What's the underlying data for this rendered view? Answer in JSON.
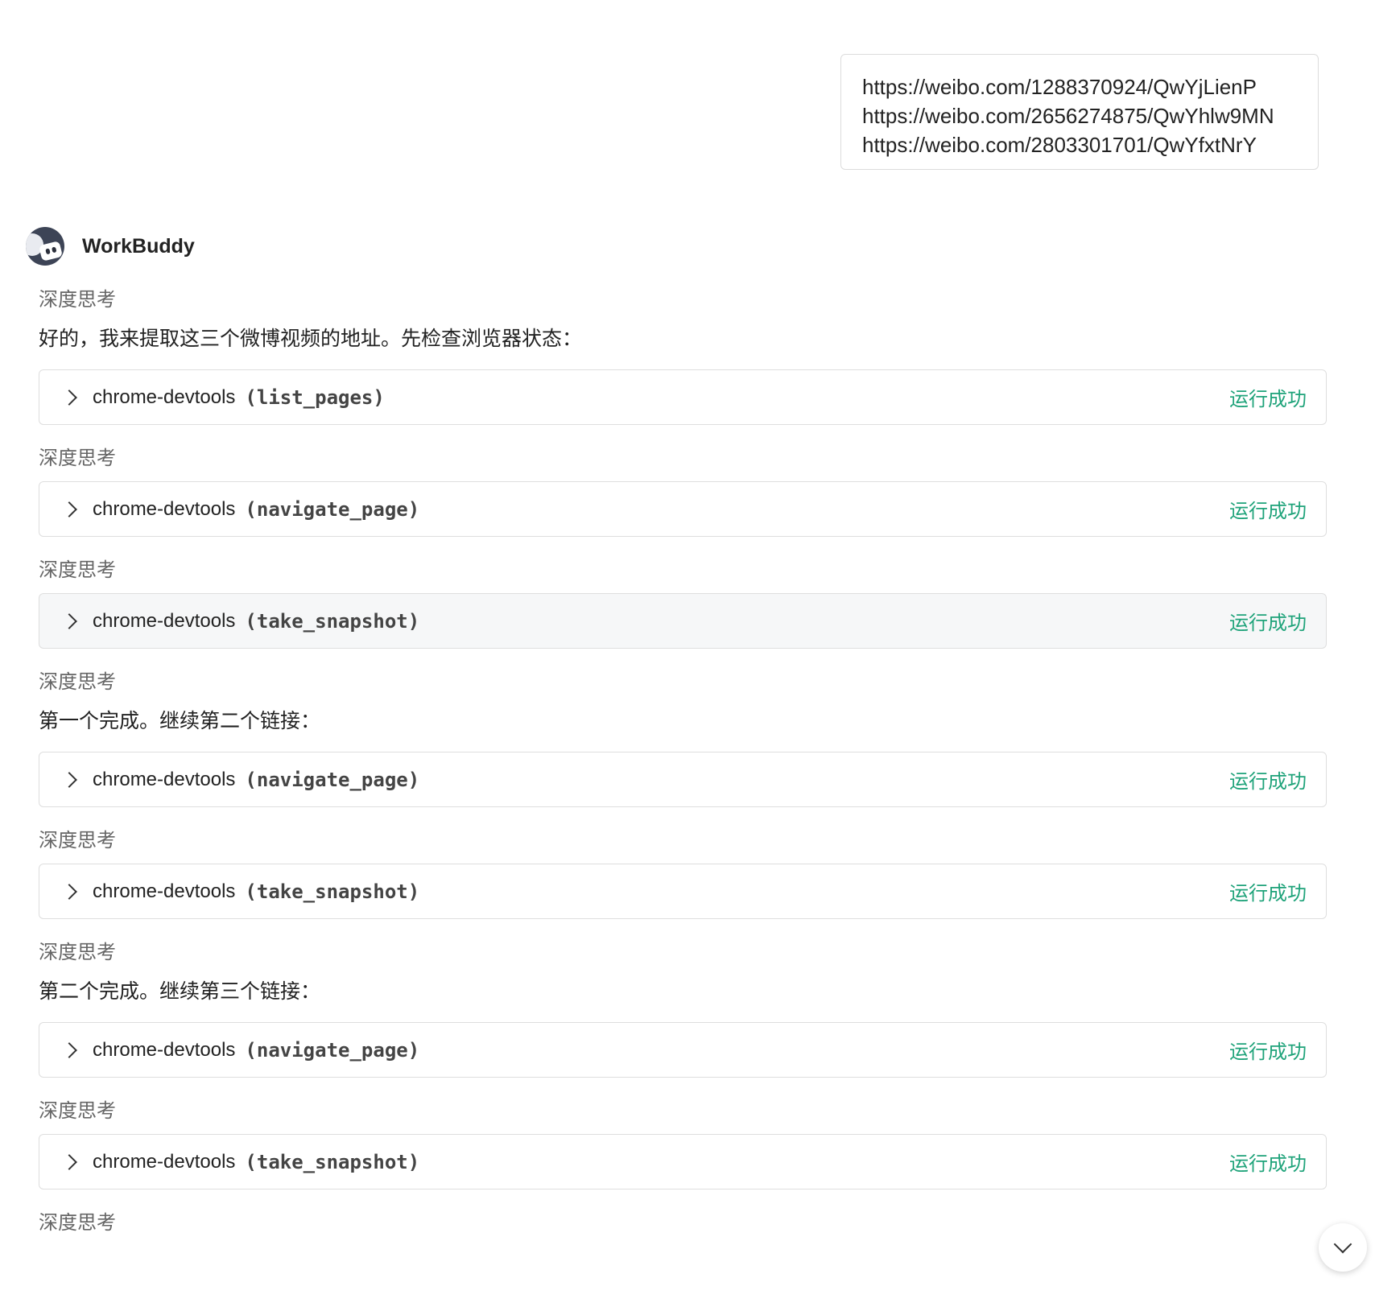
{
  "user_message": {
    "lines": [
      "https://weibo.com/1288370924/QwYjLienP",
      "https://weibo.com/2656274875/QwYhlw9MN",
      "https://weibo.com/2803301701/QwYfxtNrY"
    ]
  },
  "assistant": {
    "name": "WorkBuddy"
  },
  "labels": {
    "thinking": "深度思考",
    "status_success": "运行成功",
    "tool_prefix": "chrome-devtools"
  },
  "messages": {
    "m1": "好的，我来提取这三个微博视频的地址。先检查浏览器状态：",
    "m2": "第一个完成。继续第二个链接：",
    "m3": "第二个完成。继续第三个链接："
  },
  "tools": [
    {
      "fn": "(list_pages)"
    },
    {
      "fn": "(navigate_page)"
    },
    {
      "fn": "(take_snapshot)"
    },
    {
      "fn": "(navigate_page)"
    },
    {
      "fn": "(take_snapshot)"
    },
    {
      "fn": "(navigate_page)"
    },
    {
      "fn": "(take_snapshot)"
    }
  ]
}
